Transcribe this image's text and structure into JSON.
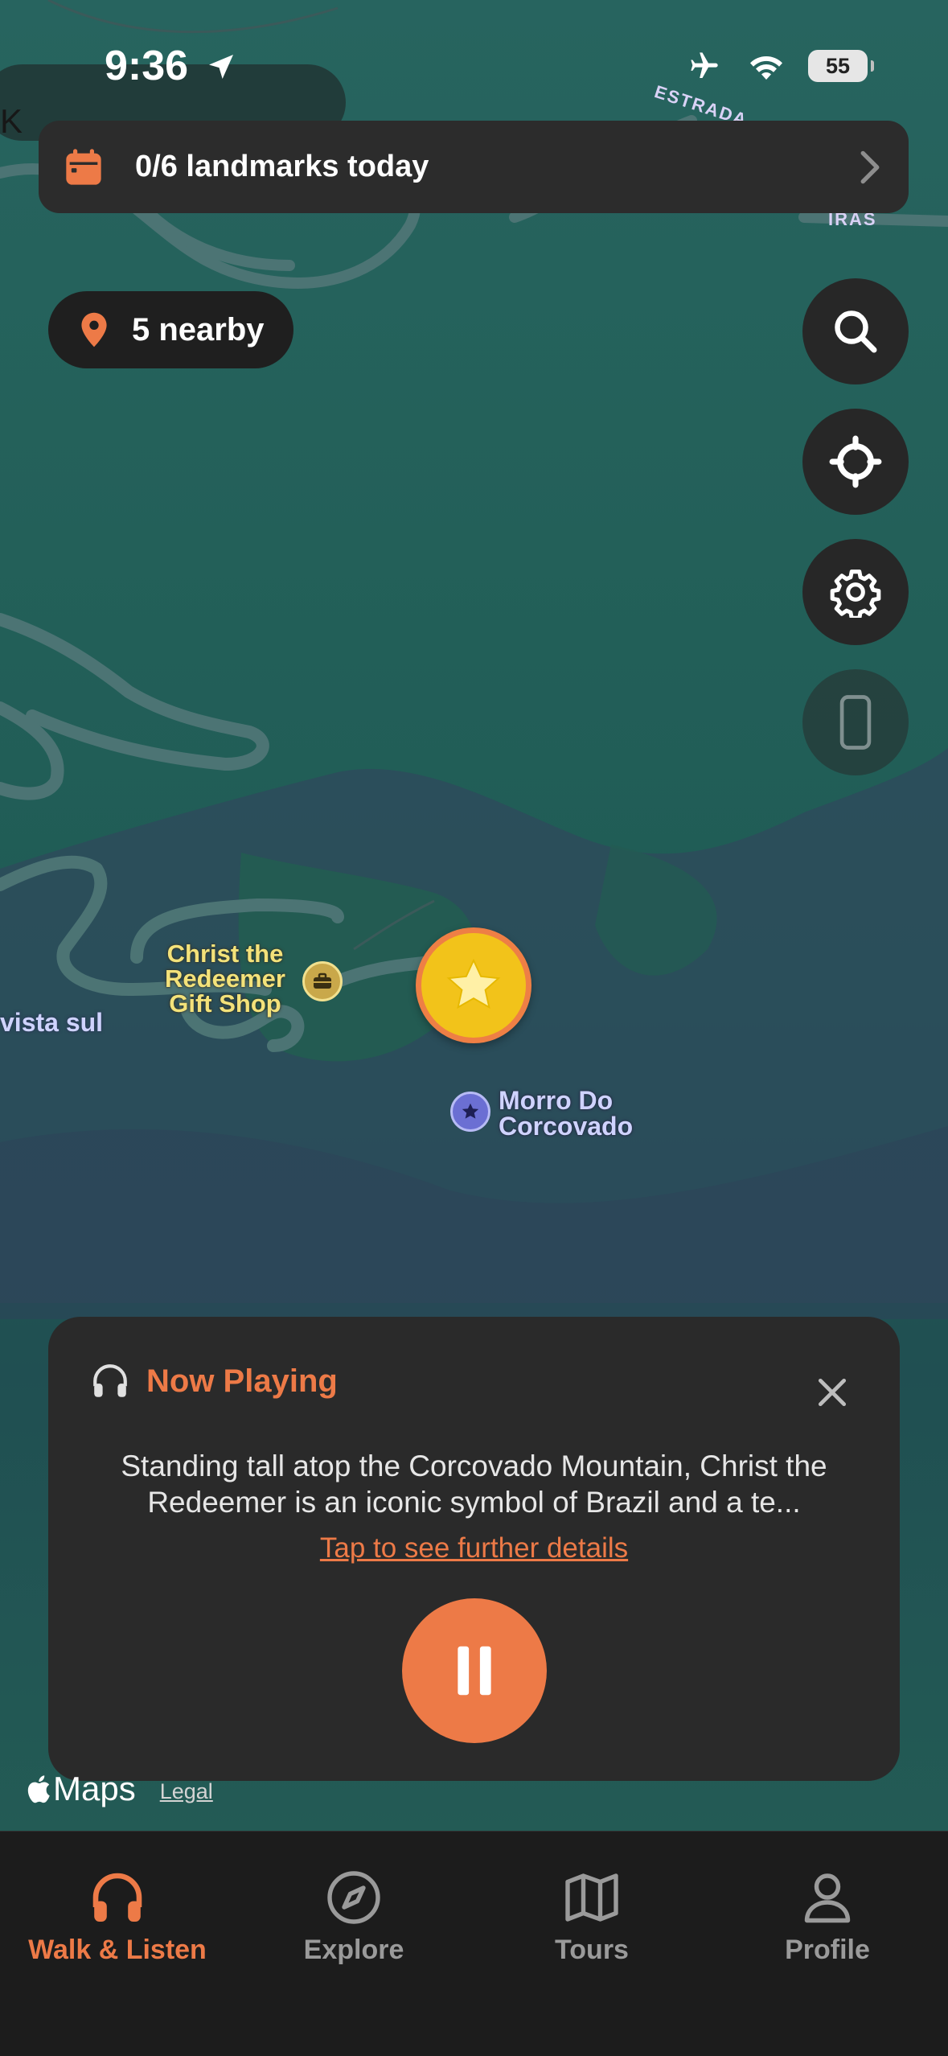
{
  "status_bar": {
    "time": "9:36",
    "battery": "55"
  },
  "map": {
    "labels": {
      "estrada": "ESTRADA",
      "ras": "IRAS",
      "k": "K",
      "gift_shop": "Christ the Redeemer Gift Shop",
      "morro": "Morro Do Corcovado",
      "vista": "vista sul"
    },
    "brand": "Maps",
    "legal": "Legal"
  },
  "banner": {
    "label": "0/6 landmarks today"
  },
  "nearby": {
    "label": "5 nearby"
  },
  "map_controls": {
    "icons": [
      "search-icon",
      "locate-icon",
      "gear-icon",
      "phone-icon"
    ]
  },
  "now_playing": {
    "title": "Now Playing",
    "description": "Standing tall atop the Corcovado Mountain, Christ the Redeemer is an iconic symbol of Brazil and a te...",
    "link": "Tap to see further details"
  },
  "tabs": [
    {
      "label": "Walk & Listen",
      "icon": "headphones-icon",
      "active": true
    },
    {
      "label": "Explore",
      "icon": "compass-icon",
      "active": false
    },
    {
      "label": "Tours",
      "icon": "map-icon",
      "active": false
    },
    {
      "label": "Profile",
      "icon": "person-icon",
      "active": false
    }
  ],
  "colors": {
    "accent": "#ED7A47",
    "map_green": "#236059",
    "card": "#2A2A2A",
    "tabbar": "#1C1C1C"
  }
}
